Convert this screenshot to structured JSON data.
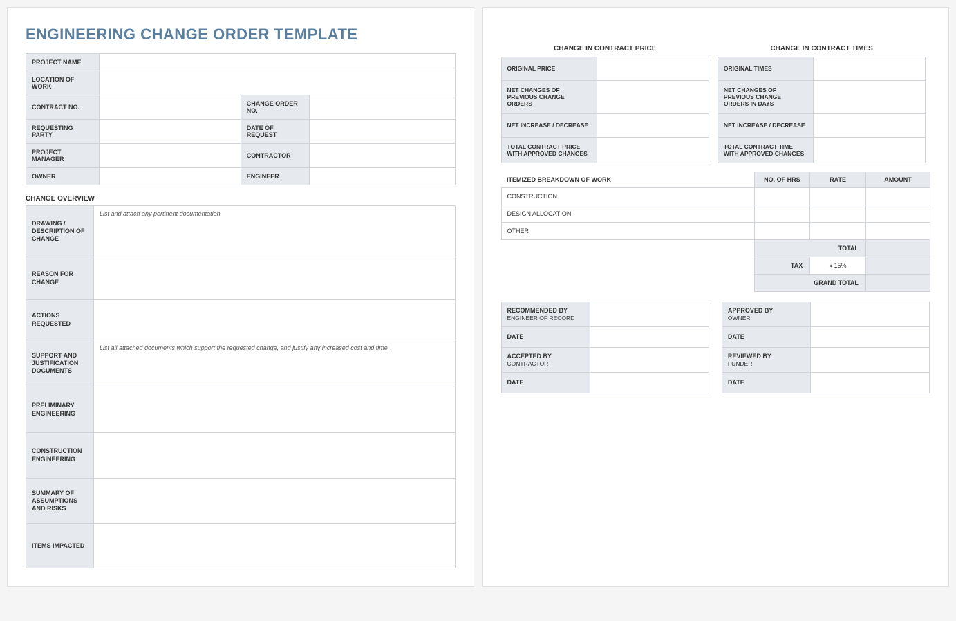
{
  "title": "ENGINEERING CHANGE ORDER TEMPLATE",
  "info": {
    "project_name_lbl": "PROJECT NAME",
    "project_name_val": "",
    "location_lbl": "LOCATION OF WORK",
    "location_val": "",
    "contract_no_lbl": "CONTRACT NO.",
    "contract_no_val": "",
    "change_order_no_lbl": "CHANGE ORDER NO.",
    "change_order_no_val": "",
    "requesting_party_lbl": "REQUESTING PARTY",
    "requesting_party_val": "",
    "date_of_request_lbl": "DATE OF REQUEST",
    "date_of_request_val": "",
    "project_manager_lbl": "PROJECT MANAGER",
    "project_manager_val": "",
    "contractor_lbl": "CONTRACTOR",
    "contractor_val": "",
    "owner_lbl": "OWNER",
    "owner_val": "",
    "engineer_lbl": "ENGINEER",
    "engineer_val": ""
  },
  "overview_heading": "CHANGE OVERVIEW",
  "overview": {
    "drawing_lbl": "DRAWING / DESCRIPTION OF CHANGE",
    "drawing_hint": "List and attach any pertinent documentation.",
    "reason_lbl": "REASON FOR CHANGE",
    "reason_val": "",
    "actions_lbl": "ACTIONS REQUESTED",
    "actions_val": "",
    "support_lbl": "SUPPORT AND JUSTIFICATION DOCUMENTS",
    "support_hint": "List all attached documents which support the requested change, and justify any increased cost and time.",
    "prelim_lbl": "PRELIMINARY ENGINEERING",
    "prelim_val": "",
    "construction_lbl": "CONSTRUCTION ENGINEERING",
    "construction_val": "",
    "summary_lbl": "SUMMARY OF ASSUMPTIONS AND RISKS",
    "summary_val": "",
    "items_lbl": "ITEMS IMPACTED",
    "items_val": ""
  },
  "contract_price_heading": "CHANGE IN CONTRACT PRICE",
  "contract_times_heading": "CHANGE IN CONTRACT TIMES",
  "price": {
    "original_lbl": "ORIGINAL PRICE",
    "original_val": "",
    "net_prev_lbl": "NET CHANGES OF PREVIOUS CHANGE ORDERS",
    "net_prev_val": "",
    "net_inc_lbl": "NET INCREASE / DECREASE",
    "net_inc_val": "",
    "total_lbl": "TOTAL CONTRACT PRICE WITH APPROVED CHANGES",
    "total_val": ""
  },
  "times": {
    "original_lbl": "ORIGINAL TIMES",
    "original_val": "",
    "net_prev_lbl": "NET CHANGES OF PREVIOUS CHANGE ORDERS IN DAYS",
    "net_prev_val": "",
    "net_inc_lbl": "NET INCREASE / DECREASE",
    "net_inc_val": "",
    "total_lbl": "TOTAL CONTRACT TIME WITH APPROVED CHANGES",
    "total_val": ""
  },
  "itemized_heading": "ITEMIZED BREAKDOWN OF WORK",
  "itemized_cols": {
    "hrs": "NO. OF HRS",
    "rate": "RATE",
    "amount": "AMOUNT"
  },
  "itemized_rows": [
    {
      "desc": "CONSTRUCTION",
      "hrs": "",
      "rate": "",
      "amount": ""
    },
    {
      "desc": "DESIGN ALLOCATION",
      "hrs": "",
      "rate": "",
      "amount": ""
    },
    {
      "desc": "OTHER",
      "hrs": "",
      "rate": "",
      "amount": ""
    }
  ],
  "totals": {
    "total_lbl": "TOTAL",
    "total_val": "",
    "tax_lbl": "TAX",
    "tax_rate": "x 15%",
    "tax_val": "",
    "grand_lbl": "GRAND TOTAL",
    "grand_val": ""
  },
  "sig": {
    "recommended_lbl": "RECOMMENDED BY",
    "recommended_sub": "ENGINEER OF RECORD",
    "recommended_val": "",
    "date_lbl": "DATE",
    "recommended_date": "",
    "approved_lbl": "APPROVED BY",
    "approved_sub": "OWNER",
    "approved_val": "",
    "approved_date": "",
    "accepted_lbl": "ACCEPTED BY",
    "accepted_sub": "CONTRACTOR",
    "accepted_val": "",
    "accepted_date": "",
    "reviewed_lbl": "REVIEWED BY",
    "reviewed_sub": "FUNDER",
    "reviewed_val": "",
    "reviewed_date": ""
  }
}
